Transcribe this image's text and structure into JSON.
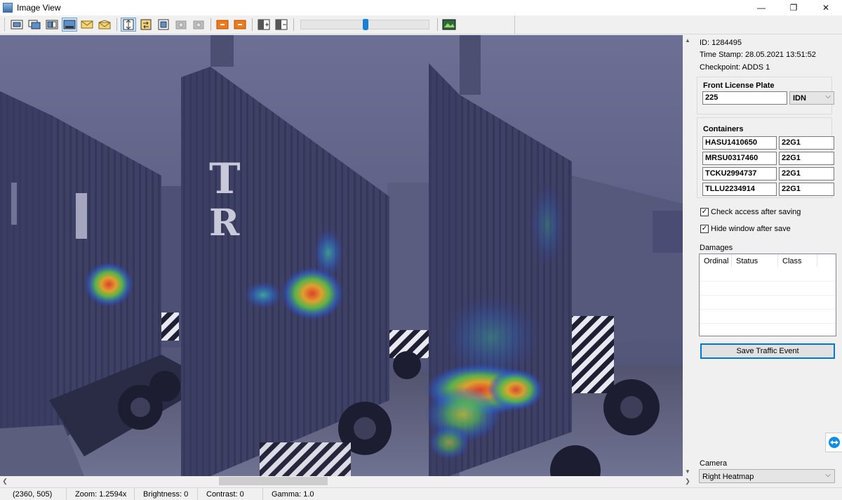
{
  "window": {
    "title": "Image View",
    "controls": {
      "minimize": "—",
      "restore": "❐",
      "close": "✕"
    }
  },
  "toolbar": {
    "buttons": [
      "layout-single-icon",
      "layout-stack-icon",
      "layout-cascade-icon",
      "layout-film-icon",
      "envelope-icon",
      "envelope-open-icon",
      "fit-height-icon",
      "swap-icon",
      "fit-icon",
      "camera-disabled-icon",
      "camera-disabled-icon",
      "prev-orange-icon",
      "next-orange-icon",
      "split-add-icon",
      "split-remove-icon",
      "export-image-icon"
    ],
    "zoom_slider_position": 0.5
  },
  "viewer": {
    "panels": 3,
    "overlay": "heatmap",
    "tint_color": "#3d3f5e"
  },
  "status": {
    "coords": "(2360, 505)",
    "zoom": "Zoom: 1.2594x",
    "brightness": "Brightness: 0",
    "contrast": "Contrast: 0",
    "gamma": "Gamma: 1.0"
  },
  "event": {
    "id": "ID: 1284495",
    "timestamp": "Time Stamp: 28.05.2021 13:51:52",
    "checkpoint": "Checkpoint: ADDS 1"
  },
  "front_plate": {
    "title": "Front License Plate",
    "value": "225",
    "country": "IDN"
  },
  "containers": {
    "title": "Containers",
    "rows": [
      {
        "code": "HASU1410650",
        "type": "22G1"
      },
      {
        "code": "MRSU0317460",
        "type": "22G1"
      },
      {
        "code": "TCKU2994737",
        "type": "22G1"
      },
      {
        "code": "TLLU2234914",
        "type": "22G1"
      }
    ]
  },
  "options": {
    "check_access_label": "Check access after saving",
    "check_access_checked": true,
    "hide_window_label": "Hide window after save",
    "hide_window_checked": true
  },
  "damages": {
    "title": "Damages",
    "columns": [
      "Ordinal",
      "Status",
      "Class"
    ]
  },
  "save_button_label": "Save Traffic Event",
  "camera": {
    "label": "Camera",
    "selected": "Right Heatmap"
  },
  "colors": {
    "accent": "#0078d7",
    "slider": "#1a7fd8",
    "toolbar_orange": "#f07a1a"
  }
}
